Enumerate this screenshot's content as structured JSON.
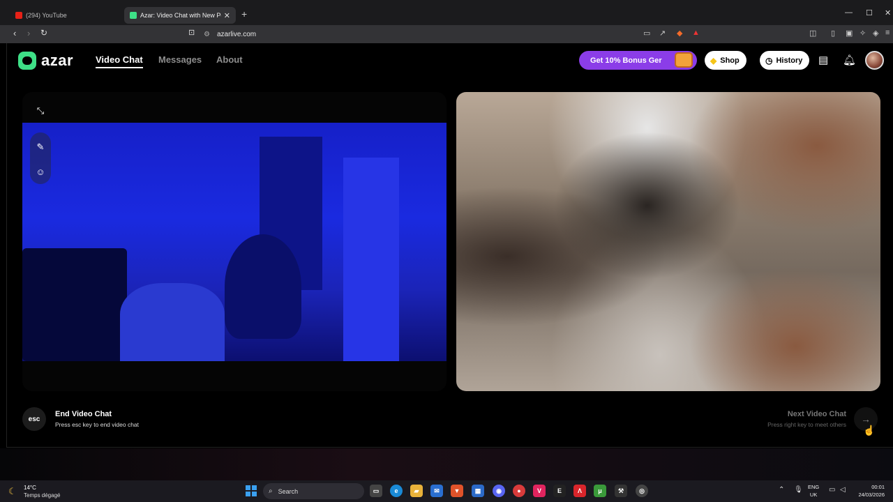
{
  "browser": {
    "tabs": [
      {
        "title": "(294) YouTube",
        "active": false,
        "favicon_color": "#e62117"
      },
      {
        "title": "Azar: Video Chat with New Pe",
        "active": true,
        "favicon_color": "#3ee087"
      }
    ],
    "url": "azarlive.com"
  },
  "header": {
    "logo_text": "azar",
    "nav": [
      {
        "label": "Video Chat",
        "active": true
      },
      {
        "label": "Messages",
        "active": false
      },
      {
        "label": "About",
        "active": false
      }
    ],
    "bonus_label": "Get 10% Bonus Ger",
    "shop_label": "Shop",
    "history_label": "History"
  },
  "footer_controls": {
    "esc_key": "esc",
    "end_title": "End Video Chat",
    "end_hint": "Press esc key to end video chat",
    "next_title": "Next Video Chat",
    "next_hint": "Press right key to meet others"
  },
  "taskbar": {
    "temperature": "14°C",
    "weather": "Temps dégagé",
    "search_label": "Search",
    "lang_line1": "ENG",
    "lang_line2": "UK",
    "time": "00:01",
    "date": "24/03/2026"
  },
  "colors": {
    "brand_green": "#3ee087",
    "bonus_purple": "#8b3de8",
    "accent_blue": "#3aa0f0"
  }
}
